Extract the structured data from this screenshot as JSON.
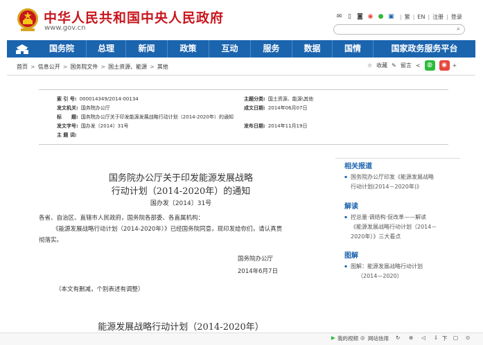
{
  "header": {
    "site_title": "中华人民共和国中央人民政府",
    "site_url": "www.gov.cn",
    "toplinks": [
      "繁",
      "EN",
      "注册",
      "登录"
    ],
    "search_placeholder": ""
  },
  "nav": {
    "items": [
      "国务院",
      "总理",
      "新闻",
      "政策",
      "互动",
      "服务",
      "数据",
      "国情",
      "国家政务服务平台"
    ]
  },
  "breadcrumb": [
    "首页",
    "信息公开",
    "国务院文件",
    "国土资源、能源",
    "其他"
  ],
  "tools": {
    "favorite": "收藏",
    "comment": "留言"
  },
  "meta": {
    "index_label": "索 引 号:",
    "index_value": "000014349/2014-00134",
    "category_label": "主题分类:",
    "category_value": "国土资源、能源\\其他",
    "issuer_label": "发文机关:",
    "issuer_value": "国务院办公厅",
    "written_label": "成文日期:",
    "written_value": "2014年06月07日",
    "title_label": "标　　题:",
    "title_value": "国务院办公厅关于印发能源发展战略行动计划（2014-2020年）的通知",
    "docno_label": "发文字号:",
    "docno_value": "国办发〔2014〕31号",
    "publish_label": "发布日期:",
    "publish_value": "2014年11月19日",
    "keyword_label": "主 题 词:",
    "keyword_value": ""
  },
  "article": {
    "title_line1": "国务院办公厅关于印发能源发展战略",
    "title_line2": "行动计划（2014-2020年）的通知",
    "doc_no": "国办发〔2014〕31号",
    "salutation": "各省、自治区、直辖市人民政府，国务院各部委、各直属机构：",
    "body_line1": "《能源发展战略行动计划（2014-2020年）》已经国务院同意，现印发给你们，请认真贯",
    "body_line2": "彻落实。",
    "signature": "国务院办公厅",
    "date": "2014年6月7日",
    "note": "（本文有删减，个别表述有调整）",
    "plan_title": "能源发展战略行动计划（2014-2020年）"
  },
  "sidebar": {
    "related_heading": "相关报道",
    "related_line1": "国务院办公厅印发《能源发展战略",
    "related_line2": "行动计划(2014－2020年)》",
    "interpret_heading": "解读",
    "interpret_line1": "控总量·调结构·促改革——解读",
    "interpret_line2": "《能源发展战略行动计划（2014－",
    "interpret_line3": "2020年）》三大看点",
    "graphic_heading": "图解",
    "graphic_line1": "图解：能源发展战略行动计划",
    "graphic_line2": "（2014—2020）"
  },
  "statusbar": {
    "video": "我的视频",
    "speed": "网站信用",
    "download": "下"
  },
  "colors": {
    "brand_red": "#c8161d",
    "nav_blue": "#1b64ae",
    "wechat_green": "#2dbb3a",
    "weibo_red": "#e8463c"
  }
}
